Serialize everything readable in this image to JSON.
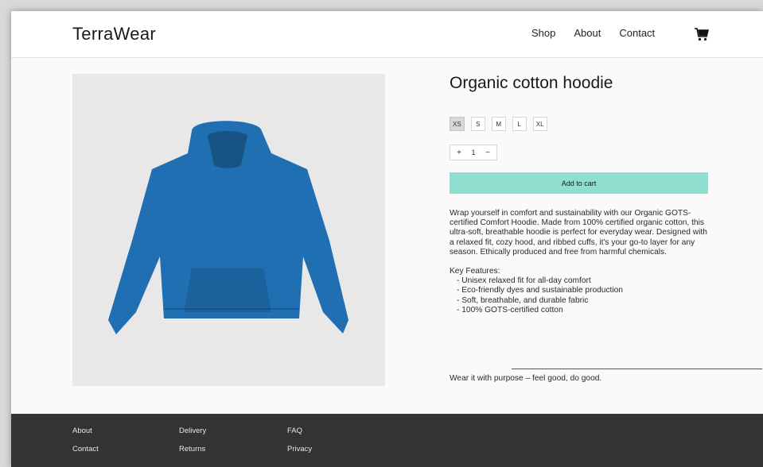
{
  "header": {
    "logo": "TerraWear",
    "nav": [
      "Shop",
      "About",
      "Contact"
    ],
    "cart_icon": "shopping-cart-icon"
  },
  "product": {
    "title": "Organic cotton hoodie",
    "sizes": [
      "XS",
      "S",
      "M",
      "L",
      "XL"
    ],
    "selected_size": "XS",
    "quantity": {
      "increment": "+",
      "value": "1",
      "decrement": "−"
    },
    "add_to_cart": "Add to cart",
    "description": "Wrap yourself in comfort and sustainability with our Organic GOTS-certified Comfort Hoodie. Made from 100% certified organic cotton, this ultra-soft, breathable hoodie is perfect for everyday wear. Designed with a relaxed fit, cozy hood, and ribbed cuffs, it's your go-to layer for any season. Ethically produced and free from harmful chemicals.",
    "features_heading": "Key Features:",
    "features": [
      "Unisex relaxed fit for all-day comfort",
      "Eco-friendly dyes and sustainable production",
      "Soft, breathable, and durable fabric",
      "100% GOTS-certified cotton"
    ],
    "tagline": "Wear it with purpose – feel good, do good.",
    "hoodie_color": "#1f6fb2"
  },
  "footer": {
    "col1": [
      "About",
      "Contact"
    ],
    "col2": [
      "Delivery",
      "Returns"
    ],
    "col3": [
      "FAQ",
      "Privacy"
    ]
  },
  "colors": {
    "accent": "#8fded0",
    "footer_bg": "#333333",
    "image_bg": "#e8e8e8"
  }
}
